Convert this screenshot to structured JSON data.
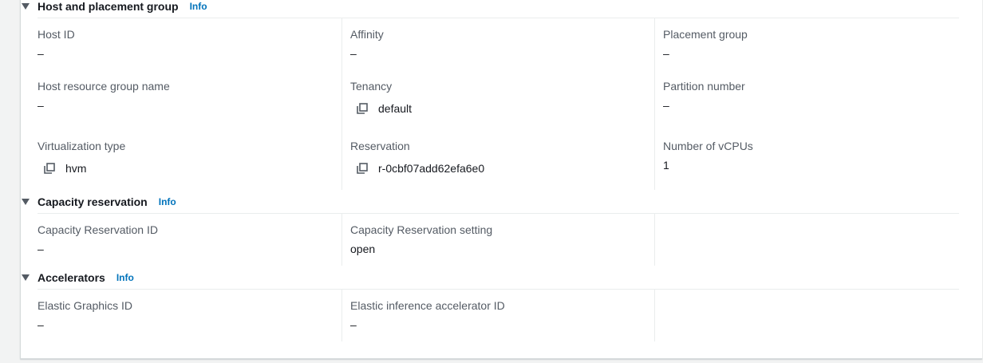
{
  "sections": {
    "host_placement": {
      "title": "Host and placement group",
      "info": "Info",
      "host_id": {
        "label": "Host ID",
        "value": "–"
      },
      "affinity": {
        "label": "Affinity",
        "value": "–"
      },
      "placement_group": {
        "label": "Placement group",
        "value": "–"
      },
      "host_resource_group": {
        "label": "Host resource group name",
        "value": "–"
      },
      "tenancy": {
        "label": "Tenancy",
        "value": "default"
      },
      "partition_number": {
        "label": "Partition number",
        "value": "–"
      },
      "virtualization_type": {
        "label": "Virtualization type",
        "value": "hvm"
      },
      "reservation": {
        "label": "Reservation",
        "value": "r-0cbf07add62efa6e0"
      },
      "vcpus": {
        "label": "Number of vCPUs",
        "value": "1"
      }
    },
    "capacity_reservation": {
      "title": "Capacity reservation",
      "info": "Info",
      "id": {
        "label": "Capacity Reservation ID",
        "value": "–"
      },
      "setting": {
        "label": "Capacity Reservation setting",
        "value": "open"
      }
    },
    "accelerators": {
      "title": "Accelerators",
      "info": "Info",
      "elastic_graphics": {
        "label": "Elastic Graphics ID",
        "value": "–"
      },
      "elastic_inference": {
        "label": "Elastic inference accelerator ID",
        "value": "–"
      }
    }
  },
  "icons": {
    "copy": "copy-icon",
    "expand": "caret-down-icon"
  },
  "colors": {
    "link": "#0073bb",
    "label": "#545b64",
    "text": "#16191f",
    "divider": "#eaeded"
  }
}
